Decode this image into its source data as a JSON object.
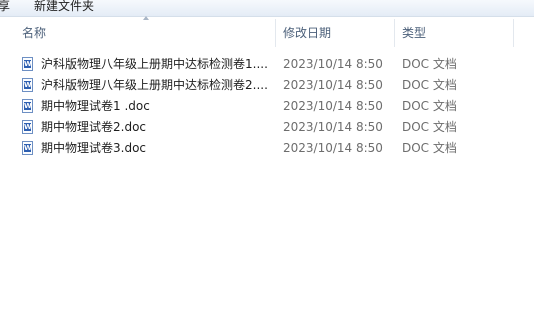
{
  "toolbar": {
    "left_fragment": "共享",
    "new_folder_label": "新建文件夹"
  },
  "columns": {
    "name": "名称",
    "date": "修改日期",
    "type": "类型"
  },
  "files": [
    {
      "name": "沪科版物理八年级上册期中达标检测卷1....",
      "date": "2023/10/14 8:50",
      "type": "DOC 文档",
      "icon": "word-doc-icon"
    },
    {
      "name": "沪科版物理八年级上册期中达标检测卷2....",
      "date": "2023/10/14 8:50",
      "type": "DOC 文档",
      "icon": "word-doc-icon"
    },
    {
      "name": "期中物理试卷1 .doc",
      "date": "2023/10/14 8:50",
      "type": "DOC 文档",
      "icon": "word-doc-icon"
    },
    {
      "name": "期中物理试卷2.doc",
      "date": "2023/10/14 8:50",
      "type": "DOC 文档",
      "icon": "word-doc-icon"
    },
    {
      "name": "期中物理试卷3.doc",
      "date": "2023/10/14 8:50",
      "type": "DOC 文档",
      "icon": "word-doc-icon"
    }
  ]
}
